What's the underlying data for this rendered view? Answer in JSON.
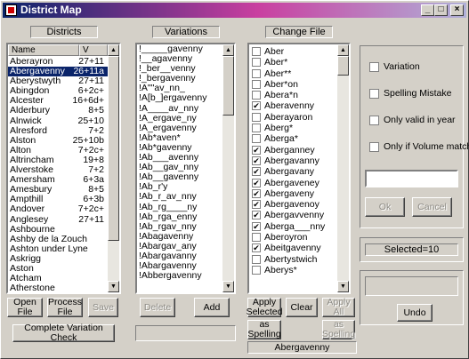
{
  "window": {
    "title": "District Map"
  },
  "labels": {
    "districts": "Districts",
    "variations": "Variations",
    "change_file": "Change File"
  },
  "districts": {
    "col_name": "Name",
    "col_value": "V",
    "rows": [
      {
        "name": "Aberayron",
        "value": "27+11"
      },
      {
        "name": "Abergavenny",
        "value": "26+11a"
      },
      {
        "name": "Aberystwyth",
        "value": "27+11"
      },
      {
        "name": "Abingdon",
        "value": "6+2c+"
      },
      {
        "name": "Alcester",
        "value": "16+6d+"
      },
      {
        "name": "Alderbury",
        "value": "8+5"
      },
      {
        "name": "Alnwick",
        "value": "25+10"
      },
      {
        "name": "Alresford",
        "value": "7+2"
      },
      {
        "name": "Alston",
        "value": "25+10b"
      },
      {
        "name": "Alton",
        "value": "7+2c+"
      },
      {
        "name": "Altrincham",
        "value": "19+8"
      },
      {
        "name": "Alverstoke",
        "value": "7+2"
      },
      {
        "name": "Amersham",
        "value": "6+3a"
      },
      {
        "name": "Amesbury",
        "value": "8+5"
      },
      {
        "name": "Ampthill",
        "value": "6+3b"
      },
      {
        "name": "Andover",
        "value": "7+2c+"
      },
      {
        "name": "Anglesey",
        "value": "27+11"
      },
      {
        "name": "Ashbourne",
        "value": ""
      },
      {
        "name": "Ashby de la Zouch",
        "value": ""
      },
      {
        "name": "Ashton under Lyne",
        "value": ""
      },
      {
        "name": "Askrigg",
        "value": ""
      },
      {
        "name": "Aston",
        "value": ""
      },
      {
        "name": "Atcham",
        "value": ""
      },
      {
        "name": "Atherstone",
        "value": ""
      }
    ],
    "selected_index": 1
  },
  "variations": {
    "rows": [
      "!_____gavenny",
      "!__agavenny",
      "!_ber__venny",
      "!_bergavenny",
      "!A\"\"av_nn_",
      "!A[b_]ergavenny",
      "!A____av_nny",
      "!A_ergave_ny",
      "!A_ergavenny",
      "!Ab*aven*",
      "!Ab*gavenny",
      "!Ab___avenny",
      "!Ab__gav_nny",
      "!Ab__gavenny",
      "!Ab_r'y",
      "!Ab_r_av_nny",
      "!Ab_rg____ny",
      "!Ab_rga_enny",
      "!Ab_rgav_nny",
      "!Abagavenny",
      "!Abargav_any",
      "!Abargavanny",
      "!Abargavenny",
      "!Abbergavenny"
    ]
  },
  "change_file": {
    "rows": [
      {
        "label": "Aber",
        "checked": false
      },
      {
        "label": "Aber*",
        "checked": false
      },
      {
        "label": "Aber**",
        "checked": false
      },
      {
        "label": "Aber*on",
        "checked": false
      },
      {
        "label": "Abera*n",
        "checked": false
      },
      {
        "label": "Aberavenny",
        "checked": true
      },
      {
        "label": "Aberayaron",
        "checked": false
      },
      {
        "label": "Aberg*",
        "checked": false
      },
      {
        "label": "Aberga*",
        "checked": false
      },
      {
        "label": "Aberganney",
        "checked": true
      },
      {
        "label": "Abergavanny",
        "checked": true
      },
      {
        "label": "Abergavany",
        "checked": true
      },
      {
        "label": "Abergaveney",
        "checked": true
      },
      {
        "label": "Abergaveny",
        "checked": true
      },
      {
        "label": "Abergavenoy",
        "checked": true
      },
      {
        "label": "Abergavvenny",
        "checked": true
      },
      {
        "label": "Aberga___nny",
        "checked": true
      },
      {
        "label": "Aberoyron",
        "checked": false
      },
      {
        "label": "Abeitgavenny",
        "checked": true
      },
      {
        "label": "Abertystwich",
        "checked": false
      },
      {
        "label": "Aberys*",
        "checked": false
      }
    ]
  },
  "options": {
    "variation": "Variation",
    "spelling_mistake": "Spelling Mistake",
    "only_valid_in_year": "Only valid in year",
    "only_if_volume_matches": "Only if Volume matches",
    "ok": "Ok",
    "cancel": "Cancel"
  },
  "status": {
    "selected": "Selected=10",
    "current": "Abergavenny"
  },
  "buttons": {
    "open_file": "Open File",
    "process_file_1": "Process",
    "process_file_2": "File",
    "save": "Save",
    "delete": "Delete",
    "add": "Add",
    "apply_selected_1": "Apply",
    "apply_selected_2": "Selected",
    "clear": "Clear",
    "apply_all": "Apply All",
    "as_spelling_1": "as",
    "as_spelling_2": "Spelling",
    "as_spelling_dis_1": "as",
    "as_spelling_dis_2": "Spelling",
    "undo": "Undo",
    "complete_variation_check": "Complete Variation Check"
  }
}
